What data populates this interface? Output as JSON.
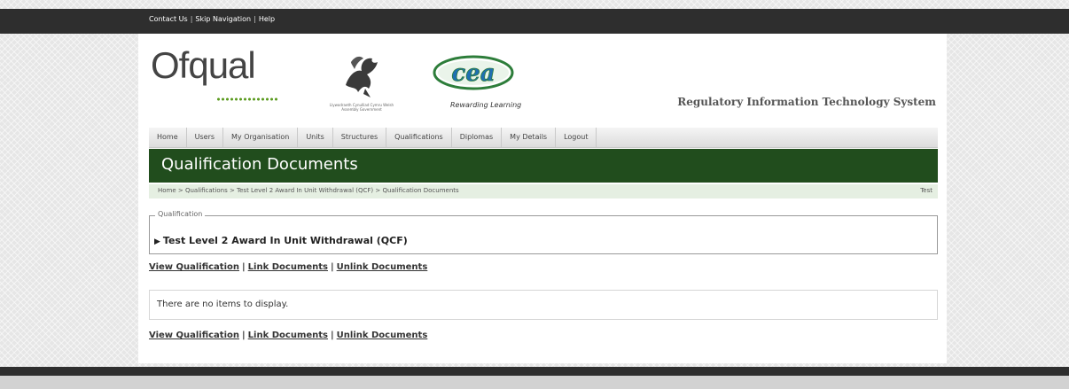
{
  "top_links": {
    "contact": "Contact Us",
    "skip": "Skip Navigation",
    "help": "Help",
    "sep": "|"
  },
  "header": {
    "ofqual_logo": "Ofqual",
    "welsh_govt_text": "Llywodraeth Cynulliad Cymru Welsh Assembly Government",
    "cea_logo": "cea",
    "cea_tagline": "Rewarding Learning",
    "system_title": "Regulatory Information Technology System"
  },
  "nav": [
    "Home",
    "Users",
    "My Organisation",
    "Units",
    "Structures",
    "Qualifications",
    "Diplomas",
    "My Details",
    "Logout"
  ],
  "page_title": "Qualification Documents",
  "breadcrumb": {
    "path": "Home > Qualifications > Test Level 2 Award In Unit Withdrawal (QCF) > Qualification Documents",
    "right": "Test"
  },
  "qualification": {
    "legend": "Qualification",
    "title": "Test Level 2 Award In Unit Withdrawal (QCF)",
    "expand_glyph": "▶"
  },
  "actions": {
    "view": "View Qualification",
    "link": "Link Documents",
    "unlink": "Unlink Documents",
    "sep": "|"
  },
  "empty_message": "There are no items to display.",
  "colors": {
    "topbar": "#2e2e2e",
    "titlebar": "#214d1d",
    "breadcrumb_bg": "#e5efe2"
  }
}
